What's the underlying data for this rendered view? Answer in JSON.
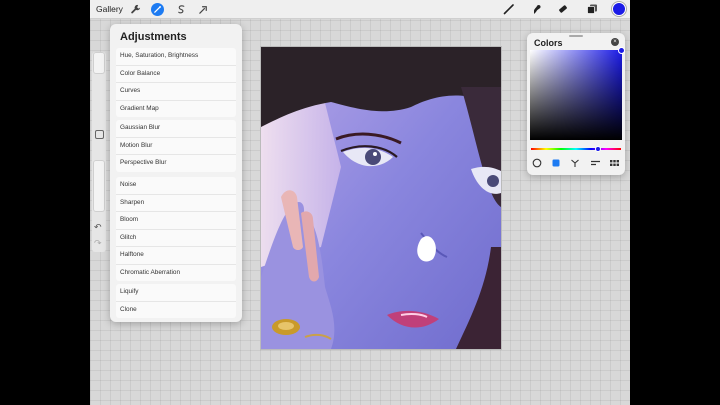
{
  "toolbar": {
    "gallery_label": "Gallery",
    "icons": [
      "wrench-icon",
      "adjustments-icon",
      "selection-icon",
      "transform-icon",
      "brush-icon",
      "smudge-icon",
      "eraser-icon",
      "layers-icon",
      "color-icon"
    ],
    "accent_color": "#1d7bf2",
    "current_color": "#1b1be6"
  },
  "sidebar": {
    "undo_label": "↶",
    "redo_label": "↷"
  },
  "adjustments": {
    "title": "Adjustments",
    "groups": [
      [
        "Hue, Saturation, Brightness",
        "Color Balance",
        "Curves",
        "Gradient Map"
      ],
      [
        "Gaussian Blur",
        "Motion Blur",
        "Perspective Blur"
      ],
      [
        "Noise",
        "Sharpen",
        "Bloom",
        "Glitch",
        "Halftone",
        "Chromatic Aberration"
      ],
      [
        "Liquify",
        "Clone"
      ]
    ]
  },
  "colors": {
    "title": "Colors",
    "close_label": "×",
    "modes": [
      "disc-icon",
      "classic-icon",
      "harmony-icon",
      "value-icon",
      "palettes-icon"
    ]
  }
}
